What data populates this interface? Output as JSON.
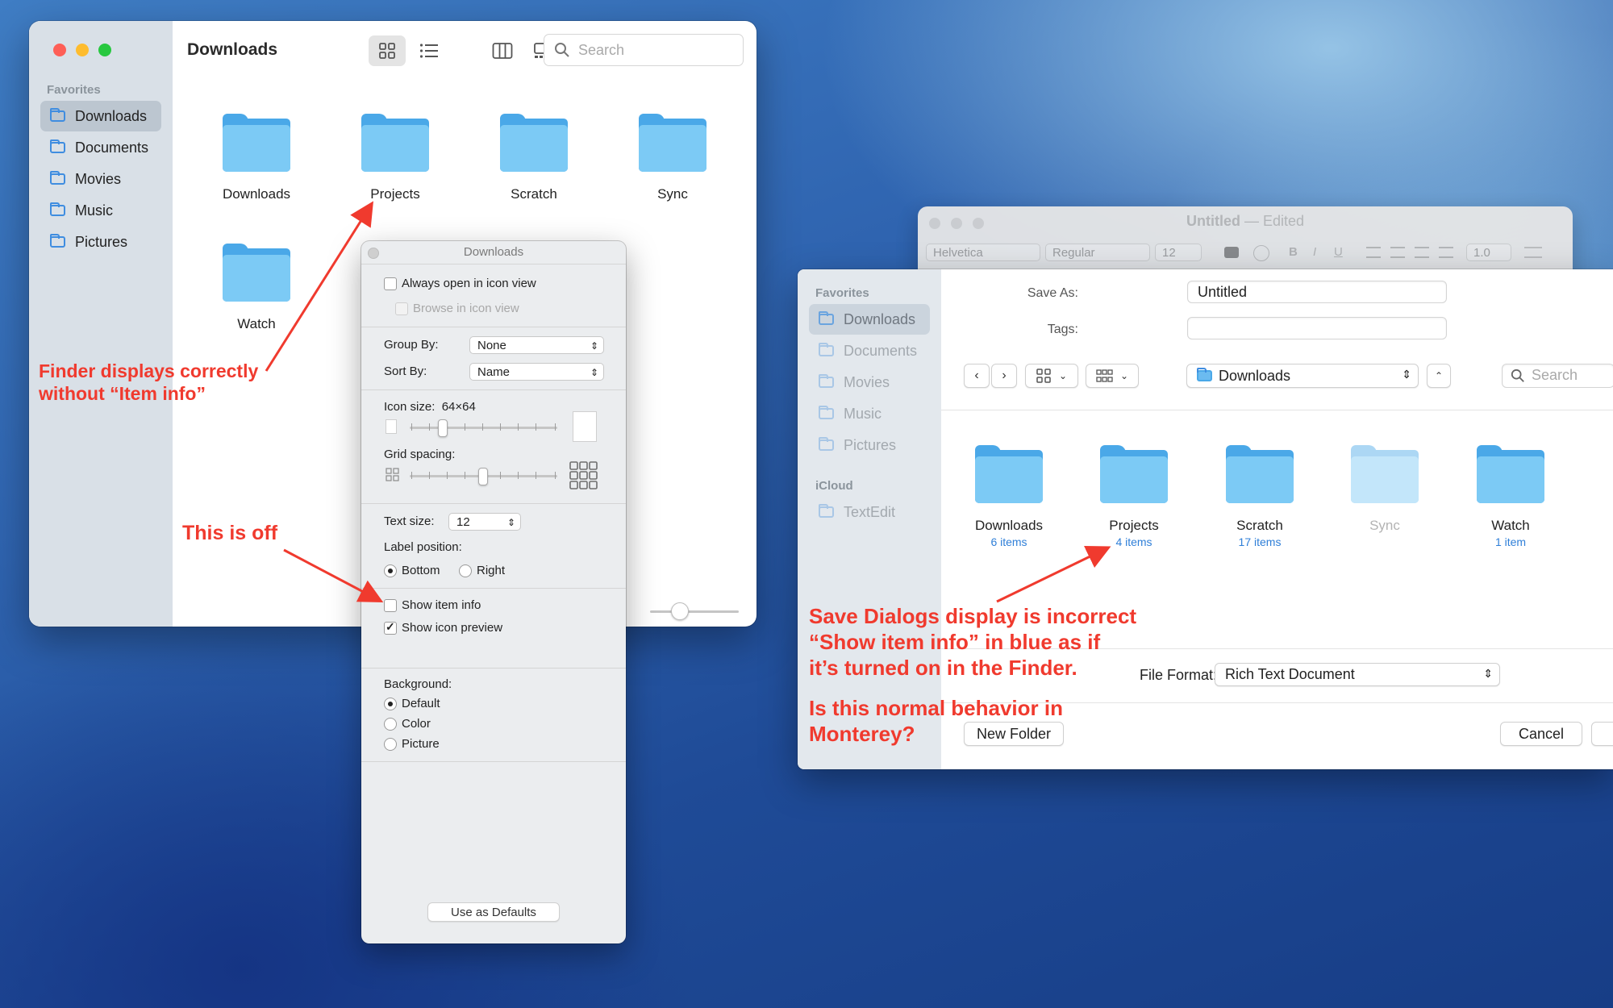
{
  "finder": {
    "title": "Downloads",
    "sidebar_heading": "Favorites",
    "sidebar_items": [
      "Downloads",
      "Documents",
      "Movies",
      "Music",
      "Pictures"
    ],
    "search_placeholder": "Search",
    "items": [
      "Downloads",
      "Projects",
      "Scratch",
      "Sync",
      "Watch"
    ],
    "icon_size_slider_value": 0.33
  },
  "view_options": {
    "title": "Downloads",
    "always_open_icon_view": "Always open in icon view",
    "browse_icon_view": "Browse in icon view",
    "group_by_label": "Group By:",
    "group_by_value": "None",
    "sort_by_label": "Sort By:",
    "sort_by_value": "Name",
    "icon_size_label": "Icon size:",
    "icon_size_value": "64×64",
    "grid_spacing_label": "Grid spacing:",
    "text_size_label": "Text size:",
    "text_size_value": "12",
    "label_position_label": "Label position:",
    "label_bottom": "Bottom",
    "label_right": "Right",
    "show_item_info": "Show item info",
    "show_item_info_checked": false,
    "show_icon_preview": "Show icon preview",
    "show_icon_preview_checked": true,
    "background_label": "Background:",
    "bg_default": "Default",
    "bg_color": "Color",
    "bg_picture": "Picture",
    "use_defaults": "Use as Defaults"
  },
  "textedit": {
    "title": "Untitled",
    "edited": "— Edited",
    "font": "Helvetica",
    "style": "Regular",
    "size": "12",
    "spacing": "1.0"
  },
  "save_dialog": {
    "favorites_heading": "Favorites",
    "sidebar_items": [
      "Downloads",
      "Documents",
      "Movies",
      "Music",
      "Pictures"
    ],
    "icloud_heading": "iCloud",
    "icloud_items": [
      "TextEdit"
    ],
    "save_as_label": "Save As:",
    "save_as_value": "Untitled",
    "tags_label": "Tags:",
    "location": "Downloads",
    "search_placeholder": "Search",
    "items": [
      {
        "name": "Downloads",
        "count": "6 items"
      },
      {
        "name": "Projects",
        "count": "4 items"
      },
      {
        "name": "Scratch",
        "count": "17 items"
      },
      {
        "name": "Sync",
        "count": ""
      },
      {
        "name": "Watch",
        "count": "1 item"
      }
    ],
    "file_format_label": "File Format:",
    "file_format_value": "Rich Text Document",
    "new_folder": "New Folder",
    "cancel": "Cancel"
  },
  "annotations": {
    "finder_note_1": "Finder displays correctly",
    "finder_note_2": "without “Item info”",
    "off_note": "This is off",
    "save_note_1": "Save Dialogs display is incorrect",
    "save_note_2": "“Show item info” in blue as if",
    "save_note_3": "it’s turned on in the Finder.",
    "question_1": "Is this normal behavior in",
    "question_2": "Monterey?"
  },
  "colors": {
    "folder_light": "#7ccaf5",
    "folder_dark": "#4aa8e8",
    "accent_blue": "#2f7fd8",
    "annotation_red": "#f03a2e"
  }
}
